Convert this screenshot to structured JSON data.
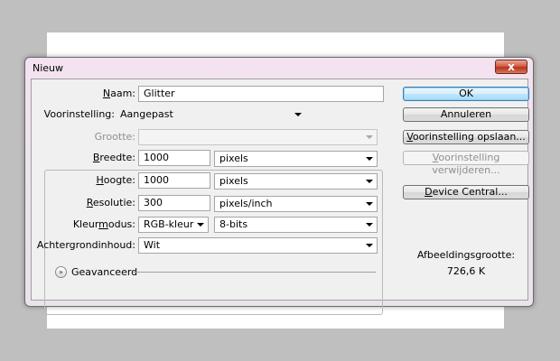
{
  "window": {
    "title": "Nieuw",
    "close_glyph": "x"
  },
  "form": {
    "name": {
      "label_prefix": "",
      "label_mnemonic": "N",
      "label_rest": "aam:",
      "value": "Glitter"
    },
    "preset": {
      "label": "Voorinstelling:",
      "value": "Aangepast"
    },
    "size": {
      "label": "Grootte:",
      "value": ""
    },
    "width": {
      "label_mnemonic": "B",
      "label_rest": "reedte:",
      "value": "1000",
      "unit": "pixels"
    },
    "height": {
      "label_mnemonic": "H",
      "label_rest": "oogte:",
      "value": "1000",
      "unit": "pixels"
    },
    "resolution": {
      "label_mnemonic": "R",
      "label_rest": "esolutie:",
      "value": "300",
      "unit": "pixels/inch"
    },
    "color_mode": {
      "label_prefix": "Kleur",
      "label_mnemonic": "m",
      "label_rest": "odus:",
      "mode": "RGB-kleur",
      "depth": "8-bits"
    },
    "background": {
      "label": "Achtergrondinhoud:",
      "value": "Wit"
    },
    "advanced": {
      "label": "Geavanceerd"
    }
  },
  "buttons": {
    "ok": "OK",
    "cancel": "Annuleren",
    "save_preset": {
      "mnemonic": "V",
      "rest": "oorinstelling opslaan..."
    },
    "delete_preset": {
      "mnemonic": "V",
      "rest": "oorinstelling verwijderen..."
    },
    "device_central": {
      "prefix": "",
      "mnemonic": "D",
      "rest": "evice Central..."
    }
  },
  "image_size": {
    "label": "Afbeeldingsgrootte:",
    "value": "726,6 K"
  },
  "icons": {
    "close": "close-icon",
    "dropdown": "chevron-down-icon",
    "advanced": "double-chevron-down-icon"
  }
}
